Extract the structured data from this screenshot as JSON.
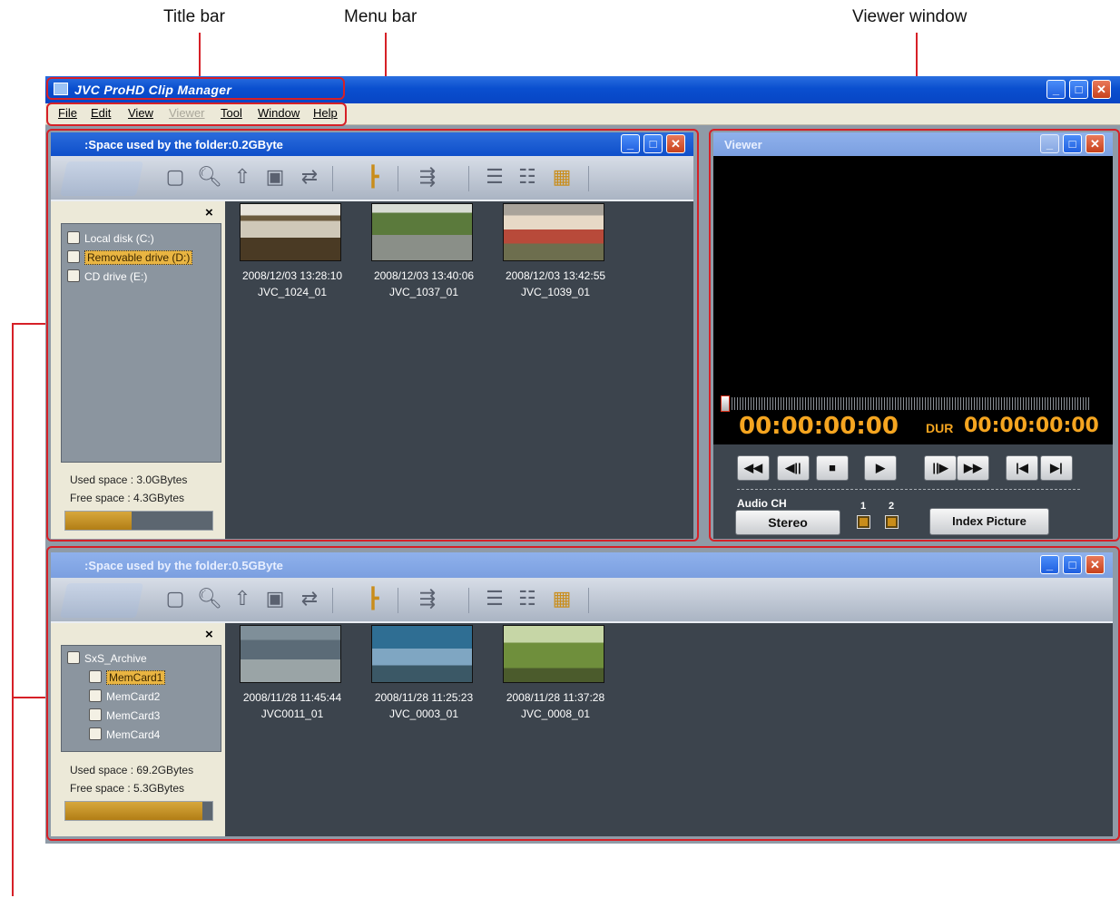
{
  "callouts": {
    "title_bar": "Title bar",
    "menu_bar": "Menu bar",
    "viewer_window": "Viewer window"
  },
  "app": {
    "title": "JVC ProHD Clip Manager",
    "menu": [
      "File",
      "Edit",
      "View",
      "Viewer",
      "Tool",
      "Window",
      "Help"
    ],
    "menu_disabled": [
      "Viewer"
    ]
  },
  "icons": {
    "toolbar": [
      "drive-icon",
      "folder-icon",
      "search-icon",
      "up-icon",
      "new-folder-icon",
      "link-icon",
      "tree-icon",
      "select-all-icon",
      "list-view-icon",
      "detail-view-icon",
      "thumbnail-view-icon"
    ]
  },
  "browser1": {
    "title": ":Space used by the folder:0.2GByte",
    "tree": [
      {
        "label": "Local disk (C:)",
        "icon": "disk-icon"
      },
      {
        "label": "Removable drive (D:)",
        "icon": "removable-drive-icon",
        "selected": true
      },
      {
        "label": "CD drive (E:)",
        "icon": "cd-icon"
      }
    ],
    "used_space": "Used space :  3.0GBytes",
    "free_space": "Free space :  4.3GBytes",
    "usage_fraction": 0.45,
    "clips": [
      {
        "date": "2008/12/03 13:28:10",
        "name": "JVC_1024_01"
      },
      {
        "date": "2008/12/03 13:40:06",
        "name": "JVC_1037_01"
      },
      {
        "date": "2008/12/03 13:42:55",
        "name": "JVC_1039_01"
      }
    ]
  },
  "browser2": {
    "title": ":Space used by the folder:0.5GByte",
    "tree_root": "SxS_Archive",
    "tree": [
      {
        "label": "MemCard1",
        "selected": true
      },
      {
        "label": "MemCard2"
      },
      {
        "label": "MemCard3"
      },
      {
        "label": "MemCard4"
      }
    ],
    "used_space": "Used space :  69.2GBytes",
    "free_space": "Free space :  5.3GBytes",
    "usage_fraction": 0.93,
    "clips": [
      {
        "date": "2008/11/28 11:45:44",
        "name": "JVC0011_01"
      },
      {
        "date": "2008/11/28 11:25:23",
        "name": "JVC_0003_01"
      },
      {
        "date": "2008/11/28 11:37:28",
        "name": "JVC_0008_01"
      }
    ]
  },
  "viewer": {
    "title": "Viewer",
    "timecode": "00:00:00:00",
    "dur_label": "DUR",
    "duration": "00:00:00:00",
    "audio_ch_label": "Audio CH",
    "stereo_label": "Stereo",
    "ch1": "1",
    "ch2": "2",
    "index_picture_label": "Index Picture",
    "close_glyph": "×"
  },
  "colors": {
    "callout_red": "#d62027",
    "title_blue": "#0a4fcf",
    "timecode_orange": "#f5a520",
    "selection_gold": "#e9b542"
  }
}
